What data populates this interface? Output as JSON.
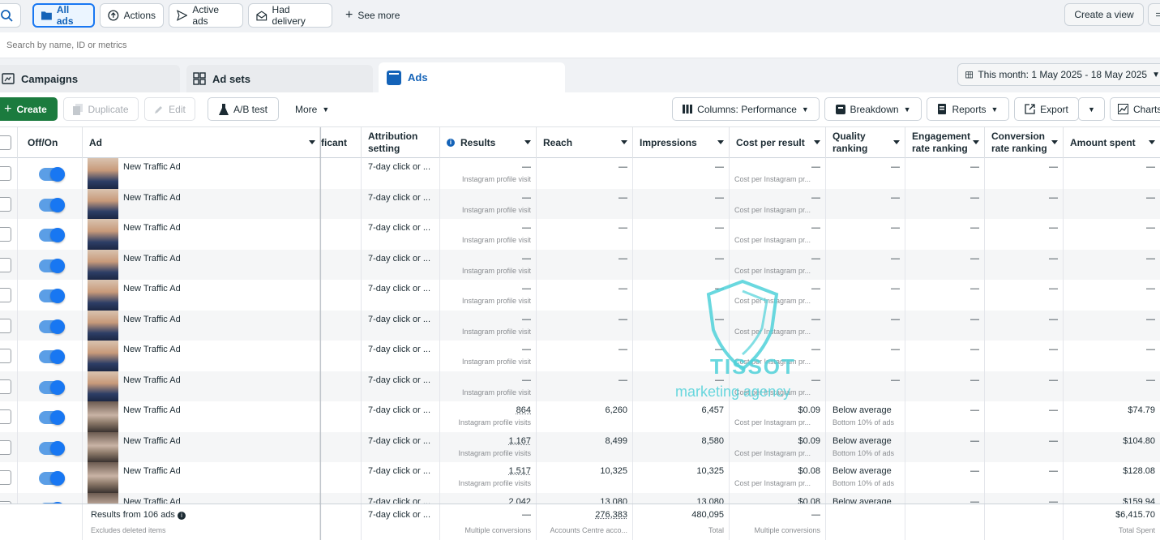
{
  "topbar": {
    "filters": {
      "all_ads": "All ads",
      "actions": "Actions",
      "active_ads": "Active ads",
      "had_delivery": "Had delivery",
      "see_more": "See more"
    },
    "create_view": "Create a view"
  },
  "search": {
    "placeholder": "Search by name, ID or metrics"
  },
  "tabs": {
    "campaigns": "Campaigns",
    "ad_sets": "Ad sets",
    "ads": "Ads"
  },
  "date_range": "This month: 1 May 2025 - 18 May 2025",
  "toolbar": {
    "create": "Create",
    "duplicate": "Duplicate",
    "edit": "Edit",
    "ab_test": "A/B test",
    "more": "More",
    "columns": "Columns: Performance",
    "breakdown": "Breakdown",
    "reports": "Reports",
    "export": "Export",
    "charts": "Charts"
  },
  "headers": {
    "off_on": "Off/On",
    "ad": "Ad",
    "partial": "ficant",
    "attribution_1": "Attribution",
    "attribution_2": "setting",
    "results": "Results",
    "reach": "Reach",
    "impressions": "Impressions",
    "cost_per_result": "Cost per result",
    "quality_1": "Quality",
    "quality_2": "ranking",
    "engagement_1": "Engagement",
    "engagement_2": "rate ranking",
    "conversion_1": "Conversion",
    "conversion_2": "rate ranking",
    "amount_spent": "Amount spent"
  },
  "rows": [
    {
      "ad": "New Traffic Ad",
      "attribution": "7-day click or ...",
      "results": "—",
      "results_sub": "Instagram profile visit",
      "reach": "—",
      "impressions": "—",
      "cpr": "—",
      "cpr_sub": "Cost per Instagram pr...",
      "quality": "—",
      "quality_sub": "",
      "engagement": "—",
      "conversion": "—",
      "spent": "—"
    },
    {
      "ad": "New Traffic Ad",
      "attribution": "7-day click or ...",
      "results": "—",
      "results_sub": "Instagram profile visit",
      "reach": "—",
      "impressions": "—",
      "cpr": "—",
      "cpr_sub": "Cost per Instagram pr...",
      "quality": "—",
      "quality_sub": "",
      "engagement": "—",
      "conversion": "—",
      "spent": "—"
    },
    {
      "ad": "New Traffic Ad",
      "attribution": "7-day click or ...",
      "results": "—",
      "results_sub": "Instagram profile visit",
      "reach": "—",
      "impressions": "—",
      "cpr": "—",
      "cpr_sub": "Cost per Instagram pr...",
      "quality": "—",
      "quality_sub": "",
      "engagement": "—",
      "conversion": "—",
      "spent": "—"
    },
    {
      "ad": "New Traffic Ad",
      "attribution": "7-day click or ...",
      "results": "—",
      "results_sub": "Instagram profile visit",
      "reach": "—",
      "impressions": "—",
      "cpr": "—",
      "cpr_sub": "Cost per Instagram pr...",
      "quality": "—",
      "quality_sub": "",
      "engagement": "—",
      "conversion": "—",
      "spent": "—"
    },
    {
      "ad": "New Traffic Ad",
      "attribution": "7-day click or ...",
      "results": "—",
      "results_sub": "Instagram profile visit",
      "reach": "—",
      "impressions": "—",
      "cpr": "—",
      "cpr_sub": "Cost per Instagram pr...",
      "quality": "—",
      "quality_sub": "",
      "engagement": "—",
      "conversion": "—",
      "spent": "—"
    },
    {
      "ad": "New Traffic Ad",
      "attribution": "7-day click or ...",
      "results": "—",
      "results_sub": "Instagram profile visit",
      "reach": "—",
      "impressions": "—",
      "cpr": "—",
      "cpr_sub": "Cost per Instagram pr...",
      "quality": "—",
      "quality_sub": "",
      "engagement": "—",
      "conversion": "—",
      "spent": "—"
    },
    {
      "ad": "New Traffic Ad",
      "attribution": "7-day click or ...",
      "results": "—",
      "results_sub": "Instagram profile visit",
      "reach": "—",
      "impressions": "—",
      "cpr": "—",
      "cpr_sub": "Cost per Instagram pr...",
      "quality": "—",
      "quality_sub": "",
      "engagement": "—",
      "conversion": "—",
      "spent": "—"
    },
    {
      "ad": "New Traffic Ad",
      "attribution": "7-day click or ...",
      "results": "—",
      "results_sub": "Instagram profile visit",
      "reach": "—",
      "impressions": "—",
      "cpr": "—",
      "cpr_sub": "Cost per Instagram pr...",
      "quality": "—",
      "quality_sub": "",
      "engagement": "—",
      "conversion": "—",
      "spent": "—"
    },
    {
      "ad": "New Traffic Ad",
      "attribution": "7-day click or ...",
      "results": "864",
      "results_sub": "Instagram profile visits",
      "reach": "6,260",
      "impressions": "6,457",
      "cpr": "$0.09",
      "cpr_sub": "Cost per Instagram pr...",
      "quality": "Below average",
      "quality_sub": "Bottom 10% of ads",
      "engagement": "—",
      "conversion": "—",
      "spent": "$74.79"
    },
    {
      "ad": "New Traffic Ad",
      "attribution": "7-day click or ...",
      "results": "1,167",
      "results_sub": "Instagram profile visits",
      "reach": "8,499",
      "impressions": "8,580",
      "cpr": "$0.09",
      "cpr_sub": "Cost per Instagram pr...",
      "quality": "Below average",
      "quality_sub": "Bottom 10% of ads",
      "engagement": "—",
      "conversion": "—",
      "spent": "$104.80"
    },
    {
      "ad": "New Traffic Ad",
      "attribution": "7-day click or ...",
      "results": "1,517",
      "results_sub": "Instagram profile visits",
      "reach": "10,325",
      "impressions": "10,325",
      "cpr": "$0.08",
      "cpr_sub": "Cost per Instagram pr...",
      "quality": "Below average",
      "quality_sub": "Bottom 10% of ads",
      "engagement": "—",
      "conversion": "—",
      "spent": "$128.08"
    },
    {
      "ad": "New Traffic Ad",
      "attribution": "7-day click or ...",
      "results": "2,042",
      "results_sub": "",
      "reach": "13,080",
      "impressions": "13,080",
      "cpr": "$0.08",
      "cpr_sub": "",
      "quality": "Below average",
      "quality_sub": "",
      "engagement": "—",
      "conversion": "—",
      "spent": "$159.94"
    }
  ],
  "footer": {
    "label": "Results from 106 ads",
    "sub": "Excludes deleted items",
    "attribution": "7-day click or ...",
    "results": "—",
    "results_sub": "Multiple conversions",
    "reach": "276,383",
    "reach_sub": "Accounts Centre acco...",
    "impressions": "480,095",
    "impressions_sub": "Total",
    "cpr": "—",
    "cpr_sub": "Multiple conversions",
    "spent": "$6,415.70",
    "spent_sub": "Total Spent"
  },
  "watermark": {
    "name": "TISSOT",
    "tagline": "marketing agency"
  },
  "colors": {
    "brand_blue": "#1877f2",
    "create_green": "#1b7b3e",
    "watermark": "#4fd1d9"
  }
}
